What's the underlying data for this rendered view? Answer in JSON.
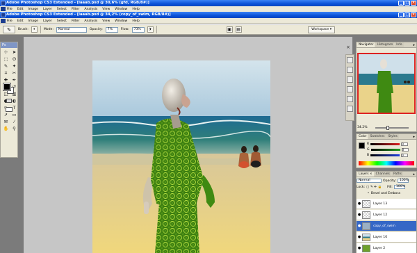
{
  "outer_window": {
    "title": "Adobe Photoshop CS3 Extended - [laaab.psd @ 30,6% (gfd, RGB/8#)]",
    "menu": [
      "File",
      "Edit",
      "Image",
      "Layer",
      "Select",
      "Filter",
      "Analysis",
      "View",
      "Window",
      "Help"
    ]
  },
  "inner_window": {
    "title": "Adobe Photoshop CS3 Extended - [laaab.psd @ 34,2% (copy_of_swim, RGB/8#)]",
    "menu": [
      "File",
      "Edit",
      "Image",
      "Layer",
      "Select",
      "Filter",
      "Analysis",
      "View",
      "Window",
      "Help"
    ]
  },
  "options_bar": {
    "brush_label": "Brush:",
    "mode_label": "Mode:",
    "mode_value": "Normal",
    "opacity_label": "Opacity:",
    "opacity_value": "7%",
    "flow_label": "Flow:",
    "flow_value": "73%",
    "workspace_label": "Workspace ▾"
  },
  "toolbox": {
    "header": "Ps",
    "tools": [
      {
        "name": "move-tool",
        "glyph": "⊹"
      },
      {
        "name": "arrow-tool",
        "glyph": "➤"
      },
      {
        "name": "marquee-tool",
        "glyph": "⬚"
      },
      {
        "name": "lasso-tool",
        "glyph": "ʘ"
      },
      {
        "name": "quick-select-tool",
        "glyph": "✎"
      },
      {
        "name": "magic-wand-tool",
        "glyph": "✦"
      },
      {
        "name": "crop-tool",
        "glyph": "⌗"
      },
      {
        "name": "slice-tool",
        "glyph": "✂"
      },
      {
        "name": "healing-tool",
        "glyph": "✚"
      },
      {
        "name": "brush-tool",
        "glyph": "✒"
      },
      {
        "name": "stamp-tool",
        "glyph": "♣"
      },
      {
        "name": "history-brush-tool",
        "glyph": "↺"
      },
      {
        "name": "eraser-tool",
        "glyph": "◫"
      },
      {
        "name": "gradient-tool",
        "glyph": "▥"
      },
      {
        "name": "blur-tool",
        "glyph": "●"
      },
      {
        "name": "dodge-tool",
        "glyph": "◐"
      },
      {
        "name": "pen-tool",
        "glyph": "✑"
      },
      {
        "name": "type-tool",
        "glyph": "T"
      },
      {
        "name": "path-select-tool",
        "glyph": "➚"
      },
      {
        "name": "shape-tool",
        "glyph": "▭"
      },
      {
        "name": "notes-tool",
        "glyph": "✉"
      },
      {
        "name": "eyedropper-tool",
        "glyph": "⁄"
      },
      {
        "name": "hand-tool",
        "glyph": "✋"
      },
      {
        "name": "zoom-tool",
        "glyph": "⚲"
      }
    ]
  },
  "navigator": {
    "tabs": [
      "Navigator",
      "Histogram",
      "Info"
    ],
    "zoom": "34.2%"
  },
  "color_panel": {
    "tabs": [
      "Color",
      "Swatches",
      "Styles"
    ],
    "channels": [
      {
        "label": "R",
        "value": "0",
        "color": "#e02020"
      },
      {
        "label": "G",
        "value": "0",
        "color": "#20a020"
      },
      {
        "label": "B",
        "value": "0",
        "color": "#2040e0"
      }
    ]
  },
  "layers_panel": {
    "tabs": [
      "Layers ×",
      "Channels",
      "Paths"
    ],
    "blend_mode": "Normal",
    "opacity_label": "Opacity:",
    "opacity_value": "100%",
    "lock_label": "Lock:",
    "fill_label": "Fill:",
    "fill_value": "100%",
    "effect_label": "Bevel and Emboss",
    "layers": [
      {
        "name": "Layer 13",
        "visible": true,
        "selected": false
      },
      {
        "name": "Layer 12",
        "visible": true,
        "selected": false
      },
      {
        "name": "copy_of_swim",
        "visible": true,
        "selected": true
      },
      {
        "name": "Layer 10",
        "visible": true,
        "selected": false
      },
      {
        "name": "Layer 2",
        "visible": true,
        "selected": false
      }
    ]
  },
  "colors": {
    "titlebar": "#0a52d8",
    "chrome": "#ece9d8",
    "canvas_bg": "#c6c6c6",
    "selection": "#3567c6"
  }
}
